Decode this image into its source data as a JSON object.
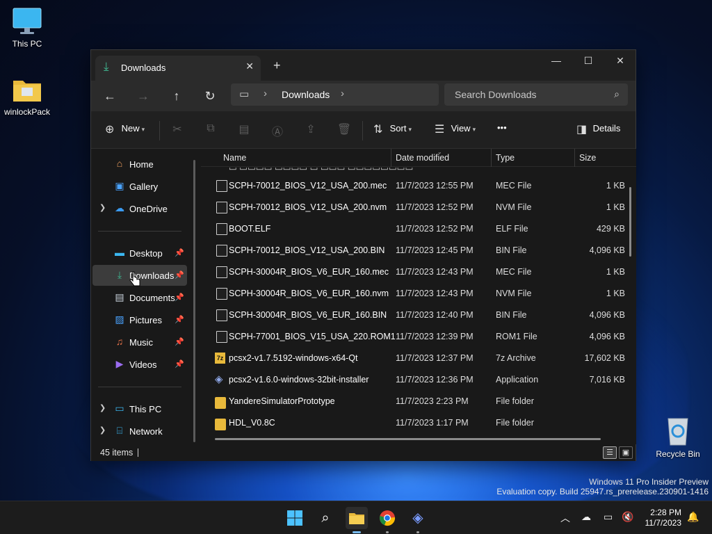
{
  "desktop": {
    "icons": [
      {
        "label": "This PC"
      },
      {
        "label": "winlockPack"
      },
      {
        "label": "Recycle Bin"
      }
    ],
    "watermark_line1": "Windows 11 Pro Insider Preview",
    "watermark_line2": "Evaluation copy. Build 25947.rs_prerelease.230901-1416"
  },
  "window": {
    "tab_title": "Downloads",
    "new_tab_label": "+",
    "address": {
      "crumb": "Downloads"
    },
    "search": {
      "placeholder": "Search Downloads"
    },
    "toolbar": {
      "new_label": "New",
      "sort_label": "Sort",
      "view_label": "View",
      "more_label": "•••",
      "details_label": "Details"
    },
    "sidebar": {
      "items": [
        {
          "label": "Home"
        },
        {
          "label": "Gallery"
        },
        {
          "label": "OneDrive"
        },
        {
          "label": "Desktop"
        },
        {
          "label": "Downloads"
        },
        {
          "label": "Documents"
        },
        {
          "label": "Pictures"
        },
        {
          "label": "Music"
        },
        {
          "label": "Videos"
        },
        {
          "label": "This PC"
        },
        {
          "label": "Network"
        }
      ]
    },
    "columns": {
      "name": "Name",
      "date": "Date modified",
      "type": "Type",
      "size": "Size"
    },
    "files": [
      {
        "name": "SCPH-70012_BIOS_V12_USA_200.mec",
        "date": "11/7/2023 12:55 PM",
        "type": "MEC File",
        "size": "1 KB",
        "kind": "file"
      },
      {
        "name": "SCPH-70012_BIOS_V12_USA_200.nvm",
        "date": "11/7/2023 12:52 PM",
        "type": "NVM File",
        "size": "1 KB",
        "kind": "file"
      },
      {
        "name": "BOOT.ELF",
        "date": "11/7/2023 12:52 PM",
        "type": "ELF File",
        "size": "429 KB",
        "kind": "file"
      },
      {
        "name": "SCPH-70012_BIOS_V12_USA_200.BIN",
        "date": "11/7/2023 12:45 PM",
        "type": "BIN File",
        "size": "4,096 KB",
        "kind": "file"
      },
      {
        "name": "SCPH-30004R_BIOS_V6_EUR_160.mec",
        "date": "11/7/2023 12:43 PM",
        "type": "MEC File",
        "size": "1 KB",
        "kind": "file"
      },
      {
        "name": "SCPH-30004R_BIOS_V6_EUR_160.nvm",
        "date": "11/7/2023 12:43 PM",
        "type": "NVM File",
        "size": "1 KB",
        "kind": "file"
      },
      {
        "name": "SCPH-30004R_BIOS_V6_EUR_160.BIN",
        "date": "11/7/2023 12:40 PM",
        "type": "BIN File",
        "size": "4,096 KB",
        "kind": "file"
      },
      {
        "name": "SCPH-77001_BIOS_V15_USA_220.ROM1",
        "date": "11/7/2023 12:39 PM",
        "type": "ROM1 File",
        "size": "4,096 KB",
        "kind": "file"
      },
      {
        "name": "pcsx2-v1.7.5192-windows-x64-Qt",
        "date": "11/7/2023 12:37 PM",
        "type": "7z Archive",
        "size": "17,602 KB",
        "kind": "archive"
      },
      {
        "name": "pcsx2-v1.6.0-windows-32bit-installer",
        "date": "11/7/2023 12:36 PM",
        "type": "Application",
        "size": "7,016 KB",
        "kind": "app"
      },
      {
        "name": "YandereSimulatorPrototype",
        "date": "11/7/2023 2:23 PM",
        "type": "File folder",
        "size": "",
        "kind": "folder"
      },
      {
        "name": "HDL_V0.8C",
        "date": "11/7/2023 1:17 PM",
        "type": "File folder",
        "size": "",
        "kind": "folder"
      }
    ],
    "status": {
      "item_count": "45 items"
    }
  },
  "taskbar": {
    "clock_time": "2:28 PM",
    "clock_date": "11/7/2023"
  },
  "colors": {
    "accent": "#76b9ed",
    "folder": "#e8b93b",
    "download_green": "#3fb58f"
  }
}
